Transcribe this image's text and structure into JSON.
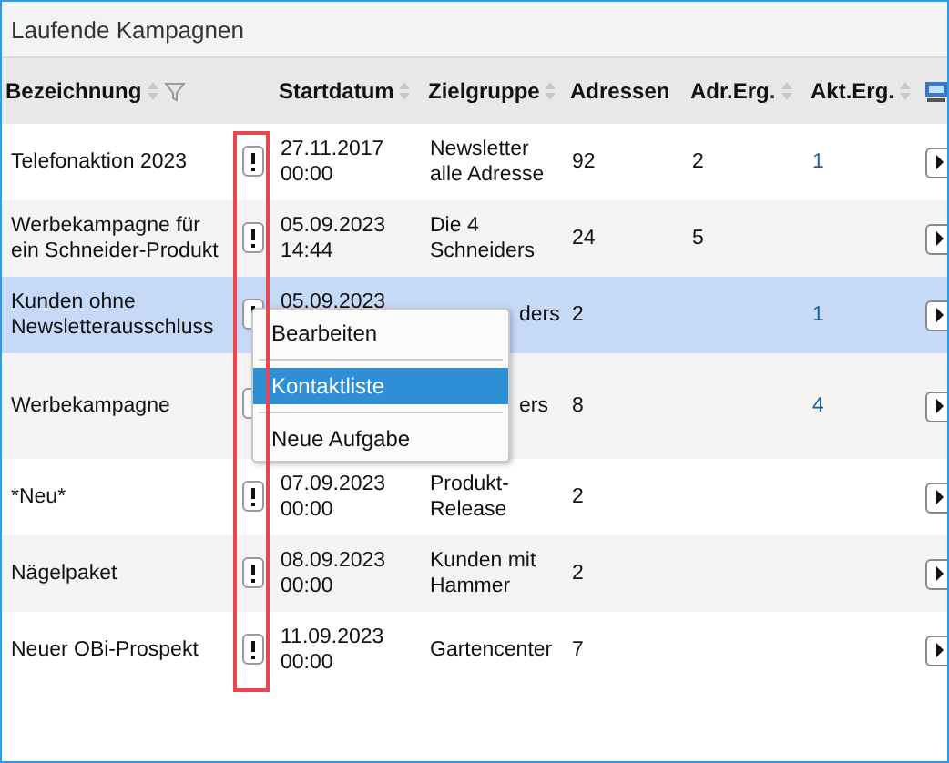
{
  "panel": {
    "title": "Laufende Kampagnen"
  },
  "table": {
    "columns": [
      {
        "label": "Bezeichnung",
        "sortable": true,
        "filterable": true
      },
      {
        "label": "Startdatum",
        "sortable": true,
        "filterable": false
      },
      {
        "label": "Zielgruppe",
        "sortable": true,
        "filterable": false
      },
      {
        "label": "Adressen",
        "sortable": false,
        "filterable": false
      },
      {
        "label": "Adr.Erg.",
        "sortable": true,
        "filterable": false
      },
      {
        "label": "Akt.Erg.",
        "sortable": true,
        "filterable": false
      }
    ],
    "rows": [
      {
        "bezeichnung": "Telefonaktion 2023",
        "startdatum": "27.11.2017 00:00",
        "zielgruppe": "Newsletter alle Adresse",
        "adressen": "92",
        "adr_erg": "2",
        "akt_erg": "1",
        "selected": false
      },
      {
        "bezeichnung": "Werbekampagne für ein Schneider-Produkt",
        "startdatum": "05.09.2023 14:44",
        "zielgruppe": "Die 4 Schneiders",
        "adressen": "24",
        "adr_erg": "5",
        "selected": false
      },
      {
        "bezeichnung": "Kunden ohne Newsletterausschluss",
        "startdatum": "05.09.2023",
        "zielgruppe_cut": "ders",
        "adressen": "2",
        "akt_erg": "1",
        "selected": true
      },
      {
        "bezeichnung": "Werbekampagne",
        "zielgruppe_cut": "ers",
        "adressen": "8",
        "akt_erg": "4",
        "selected": false
      },
      {
        "bezeichnung": "*Neu*",
        "startdatum": "07.09.2023 00:00",
        "zielgruppe": "Produkt-Release",
        "adressen": "2",
        "selected": false
      },
      {
        "bezeichnung": "Nägelpaket",
        "startdatum": "08.09.2023 00:00",
        "zielgruppe": "Kunden mit Hammer",
        "adressen": "2",
        "selected": false
      },
      {
        "bezeichnung": "Neuer OBi-Prospekt",
        "startdatum": "11.09.2023 00:00",
        "zielgruppe": "Gartencenter",
        "adressen": "7",
        "selected": false
      }
    ]
  },
  "context_menu": {
    "items": [
      {
        "label": "Bearbeiten",
        "selected": false
      },
      {
        "label": "Kontaktliste",
        "selected": true
      },
      {
        "label": "Neue Aufgabe",
        "selected": false
      }
    ]
  }
}
